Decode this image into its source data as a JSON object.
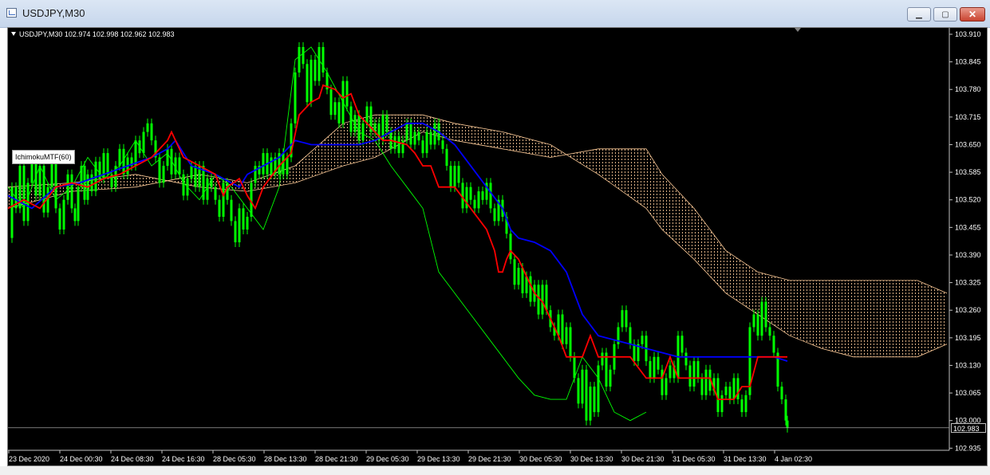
{
  "window": {
    "title": "USDJPY,M30",
    "minimize_label": "▁",
    "maximize_label": "▢",
    "close_label": "✕"
  },
  "chart": {
    "symbol_info": "USDJPY,M30  102.974 102.998 102.962 102.983",
    "indicator_label": "IchimokuMTF(60)",
    "current_price": "102.983"
  },
  "chart_data": {
    "type": "line",
    "colors": {
      "background": "#000000",
      "price": "#00ff00",
      "tenkan": "#ff0000",
      "kijun": "#0000ff",
      "chikou": "#00ff00",
      "cloud": "#ffcc99",
      "grid_text": "#ffffff"
    },
    "ylim": [
      102.93,
      103.925
    ],
    "y_ticks": [
      "103.910",
      "103.845",
      "103.780",
      "103.715",
      "103.650",
      "103.585",
      "103.520",
      "103.455",
      "103.390",
      "103.325",
      "103.260",
      "103.195",
      "103.130",
      "103.065",
      "103.000",
      "102.935"
    ],
    "x_ticks": [
      "23 Dec 2020",
      "24 Dec 00:30",
      "24 Dec 08:30",
      "24 Dec 16:30",
      "28 Dec 05:30",
      "28 Dec 13:30",
      "28 Dec 21:30",
      "29 Dec 05:30",
      "29 Dec 13:30",
      "29 Dec 21:30",
      "30 Dec 05:30",
      "30 Dec 13:30",
      "30 Dec 21:30",
      "31 Dec 05:30",
      "31 Dec 13:30",
      "4 Jan 02:30"
    ],
    "current_price": 102.983,
    "series": [
      {
        "role": "price",
        "t": [
          0,
          5,
          10,
          15,
          20,
          25,
          30,
          35,
          40,
          45,
          50,
          55,
          60,
          65,
          70,
          75,
          80,
          84,
          88,
          92,
          96,
          100,
          105,
          110,
          115,
          120,
          125,
          130,
          135,
          140,
          145,
          150,
          155,
          160,
          165,
          170,
          175,
          180,
          185,
          190,
          195,
          200,
          205,
          210,
          215,
          220,
          225,
          230,
          235,
          240,
          245,
          250,
          255,
          260,
          265,
          270,
          275,
          280,
          285,
          290,
          295,
          300,
          305,
          310,
          315,
          320,
          325,
          330,
          335,
          340,
          345,
          350,
          355,
          360,
          365,
          370,
          375,
          380,
          385,
          390,
          395,
          400,
          405,
          410,
          415,
          420,
          425,
          430,
          435,
          440,
          445,
          450,
          455,
          460,
          465,
          470,
          475,
          480,
          485,
          490,
          495,
          500,
          505,
          510,
          515,
          520,
          525,
          530,
          535,
          540,
          545,
          550,
          555,
          560,
          565,
          570,
          575,
          580,
          585,
          590,
          595,
          600,
          605,
          610,
          615,
          620,
          625,
          630,
          635,
          640,
          645,
          650,
          655,
          660,
          665,
          670,
          675,
          680,
          685,
          690,
          695,
          700,
          705,
          710,
          715,
          720,
          725,
          730,
          735,
          740,
          745,
          750,
          755,
          760,
          765,
          770,
          775,
          780,
          785,
          790,
          795,
          800,
          805,
          810,
          815,
          820,
          825,
          830,
          835,
          840,
          845,
          850,
          855,
          860,
          865,
          870,
          875,
          880,
          885,
          890,
          895,
          900,
          905,
          910,
          915,
          920,
          925,
          930,
          935,
          940,
          945,
          950,
          955,
          960,
          965,
          970,
          975,
          977
        ],
        "values": [
          103.43,
          103.55,
          103.5,
          103.6,
          103.47,
          103.56,
          103.62,
          103.53,
          103.6,
          103.49,
          103.55,
          103.62,
          103.5,
          103.45,
          103.52,
          103.58,
          103.5,
          103.47,
          103.55,
          103.6,
          103.52,
          103.58,
          103.54,
          103.61,
          103.57,
          103.63,
          103.58,
          103.55,
          103.6,
          103.64,
          103.58,
          103.62,
          103.6,
          103.66,
          103.63,
          103.68,
          103.7,
          103.66,
          103.62,
          103.56,
          103.6,
          103.64,
          103.58,
          103.62,
          103.58,
          103.53,
          103.57,
          103.6,
          103.55,
          103.6,
          103.52,
          103.57,
          103.55,
          103.52,
          103.48,
          103.56,
          103.52,
          103.47,
          103.42,
          103.5,
          103.45,
          103.48,
          103.56,
          103.6,
          103.58,
          103.63,
          103.58,
          103.62,
          103.58,
          103.63,
          103.58,
          103.62,
          103.7,
          103.82,
          103.88,
          103.84,
          103.75,
          103.85,
          103.8,
          103.88,
          103.82,
          103.78,
          103.72,
          103.75,
          103.7,
          103.8,
          103.74,
          103.68,
          103.72,
          103.66,
          103.7,
          103.74,
          103.68,
          103.7,
          103.66,
          103.72,
          103.68,
          103.64,
          103.67,
          103.63,
          103.66,
          103.7,
          103.65,
          103.68,
          103.66,
          103.63,
          103.68,
          103.65,
          103.7,
          103.66,
          103.64,
          103.6,
          103.55,
          103.6,
          103.56,
          103.5,
          103.55,
          103.52,
          103.5,
          103.54,
          103.52,
          103.56,
          103.5,
          103.47,
          103.52,
          103.48,
          103.44,
          103.38,
          103.32,
          103.36,
          103.3,
          103.34,
          103.28,
          103.32,
          103.25,
          103.32,
          103.26,
          103.22,
          103.2,
          103.25,
          103.18,
          103.22,
          103.15,
          103.1,
          103.04,
          103.12,
          103.0,
          103.08,
          103.02,
          103.13,
          103.16,
          103.08,
          103.12,
          103.18,
          103.22,
          103.26,
          103.22,
          103.18,
          103.14,
          103.18,
          103.2,
          103.14,
          103.1,
          103.15,
          103.12,
          103.06,
          103.1,
          103.13,
          103.1,
          103.2,
          103.16,
          103.13,
          103.08,
          103.14,
          103.1,
          103.06,
          103.12,
          103.07,
          103.1,
          103.02,
          103.06,
          103.08,
          103.05,
          103.1,
          103.05,
          103.02,
          103.06,
          103.22,
          103.25,
          103.2,
          103.28,
          103.22,
          103.2,
          103.16,
          103.08,
          103.05,
          103.0,
          102.983
        ]
      },
      {
        "role": "tenkan",
        "t": [
          0,
          20,
          40,
          60,
          80,
          100,
          120,
          140,
          160,
          180,
          200,
          205,
          210,
          220,
          240,
          260,
          270,
          275,
          290,
          300,
          310,
          320,
          340,
          355,
          365,
          380,
          390,
          395,
          410,
          420,
          430,
          440,
          450,
          460,
          470,
          480,
          500,
          510,
          520,
          530,
          540,
          550,
          560,
          580,
          600,
          610,
          615,
          620,
          625,
          630,
          640,
          650,
          660,
          670,
          680,
          690,
          700,
          710,
          720,
          730,
          740,
          750,
          760,
          780,
          800,
          810,
          820,
          830,
          840,
          850,
          860,
          870,
          880,
          890,
          900,
          910,
          920,
          930,
          940,
          950,
          960,
          970,
          977
        ],
        "values": [
          103.5,
          103.52,
          103.5,
          103.55,
          103.56,
          103.55,
          103.57,
          103.58,
          103.6,
          103.62,
          103.66,
          103.68,
          103.66,
          103.62,
          103.6,
          103.58,
          103.53,
          103.55,
          103.57,
          103.53,
          103.5,
          103.55,
          103.6,
          103.63,
          103.72,
          103.75,
          103.76,
          103.79,
          103.78,
          103.76,
          103.77,
          103.72,
          103.7,
          103.68,
          103.66,
          103.66,
          103.65,
          103.63,
          103.6,
          103.6,
          103.55,
          103.55,
          103.55,
          103.5,
          103.45,
          103.4,
          103.35,
          103.35,
          103.38,
          103.4,
          103.38,
          103.34,
          103.3,
          103.28,
          103.24,
          103.2,
          103.15,
          103.15,
          103.15,
          103.2,
          103.15,
          103.15,
          103.15,
          103.15,
          103.1,
          103.1,
          103.1,
          103.15,
          103.1,
          103.1,
          103.1,
          103.1,
          103.1,
          103.05,
          103.05,
          103.05,
          103.08,
          103.08,
          103.15,
          103.15,
          103.15,
          103.15,
          103.15
        ]
      },
      {
        "role": "kijun",
        "t": [
          0,
          30,
          60,
          90,
          120,
          150,
          180,
          200,
          210,
          230,
          260,
          290,
          300,
          320,
          340,
          360,
          380,
          400,
          420,
          440,
          460,
          480,
          500,
          520,
          540,
          560,
          580,
          600,
          620,
          630,
          640,
          660,
          680,
          700,
          720,
          740,
          760,
          780,
          800,
          820,
          840,
          860,
          880,
          900,
          920,
          940,
          960,
          977
        ],
        "values": [
          103.53,
          103.5,
          103.55,
          103.56,
          103.58,
          103.6,
          103.62,
          103.64,
          103.66,
          103.6,
          103.58,
          103.55,
          103.58,
          103.6,
          103.62,
          103.66,
          103.65,
          103.65,
          103.65,
          103.65,
          103.66,
          103.68,
          103.7,
          103.7,
          103.68,
          103.65,
          103.6,
          103.55,
          103.5,
          103.45,
          103.43,
          103.42,
          103.4,
          103.35,
          103.25,
          103.2,
          103.19,
          103.18,
          103.17,
          103.16,
          103.15,
          103.15,
          103.15,
          103.15,
          103.15,
          103.15,
          103.15,
          103.14
        ]
      },
      {
        "role": "chikou",
        "t": [
          0,
          20,
          40,
          60,
          80,
          100,
          120,
          140,
          160,
          180,
          200,
          220,
          240,
          260,
          280,
          300,
          320,
          340,
          360,
          380,
          400,
          420,
          440,
          460,
          480,
          500,
          520,
          540,
          560,
          580,
          600,
          620,
          640,
          660,
          680,
          700,
          720,
          740,
          760,
          780,
          800
        ],
        "values": [
          103.55,
          103.5,
          103.6,
          103.52,
          103.55,
          103.62,
          103.57,
          103.6,
          103.66,
          103.6,
          103.63,
          103.56,
          103.52,
          103.58,
          103.55,
          103.5,
          103.45,
          103.55,
          103.85,
          103.88,
          103.82,
          103.75,
          103.68,
          103.66,
          103.6,
          103.55,
          103.5,
          103.35,
          103.3,
          103.25,
          103.2,
          103.15,
          103.1,
          103.06,
          103.05,
          103.05,
          103.15,
          103.1,
          103.02,
          103.0,
          103.02
        ]
      },
      {
        "role": "senkou_a",
        "t": [
          0,
          80,
          160,
          240,
          300,
          360,
          420,
          460,
          520,
          560,
          620,
          680,
          740,
          800,
          820,
          860,
          900,
          940,
          980,
          1020,
          1060,
          1100,
          1140,
          1177
        ],
        "values": [
          103.5,
          103.54,
          103.55,
          103.58,
          103.56,
          103.6,
          103.7,
          103.72,
          103.72,
          103.7,
          103.68,
          103.65,
          103.58,
          103.5,
          103.45,
          103.38,
          103.3,
          103.25,
          103.2,
          103.17,
          103.15,
          103.15,
          103.15,
          103.18
        ]
      },
      {
        "role": "senkou_b",
        "t": [
          0,
          80,
          160,
          240,
          300,
          360,
          420,
          460,
          520,
          560,
          620,
          680,
          740,
          800,
          820,
          860,
          900,
          940,
          980,
          1020,
          1060,
          1100,
          1140,
          1177
        ],
        "values": [
          103.55,
          103.56,
          103.58,
          103.55,
          103.54,
          103.56,
          103.6,
          103.62,
          103.68,
          103.66,
          103.64,
          103.62,
          103.64,
          103.64,
          103.58,
          103.5,
          103.4,
          103.35,
          103.33,
          103.33,
          103.33,
          103.33,
          103.33,
          103.3
        ]
      }
    ]
  }
}
